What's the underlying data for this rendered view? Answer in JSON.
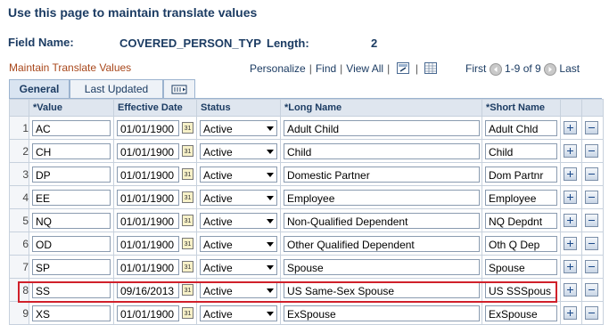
{
  "page": {
    "title": "Use this page to maintain translate values",
    "field_name_label": "Field Name:",
    "field_name_value": "COVERED_PERSON_TYP",
    "length_label": "Length:",
    "length_value": "2"
  },
  "grid": {
    "title": "Maintain Translate Values",
    "personalize": "Personalize",
    "find": "Find",
    "view_all": "View All",
    "first": "First",
    "range": "1-9 of 9",
    "last": "Last",
    "tabs": [
      "General",
      "Last Updated"
    ],
    "columns": [
      "*Value",
      "Effective Date",
      "Status",
      "*Long Name",
      "*Short Name"
    ],
    "rows": [
      {
        "num": "1",
        "value": "AC",
        "date": "01/01/1900",
        "status": "Active",
        "long": "Adult Child",
        "short": "Adult Chld"
      },
      {
        "num": "2",
        "value": "CH",
        "date": "01/01/1900",
        "status": "Active",
        "long": "Child",
        "short": "Child"
      },
      {
        "num": "3",
        "value": "DP",
        "date": "01/01/1900",
        "status": "Active",
        "long": "Domestic Partner",
        "short": "Dom Partnr"
      },
      {
        "num": "4",
        "value": "EE",
        "date": "01/01/1900",
        "status": "Active",
        "long": "Employee",
        "short": "Employee"
      },
      {
        "num": "5",
        "value": "NQ",
        "date": "01/01/1900",
        "status": "Active",
        "long": "Non-Qualified Dependent",
        "short": "NQ Depdnt"
      },
      {
        "num": "6",
        "value": "OD",
        "date": "01/01/1900",
        "status": "Active",
        "long": "Other Qualified Dependent",
        "short": "Oth Q Dep"
      },
      {
        "num": "7",
        "value": "SP",
        "date": "01/01/1900",
        "status": "Active",
        "long": "Spouse",
        "short": "Spouse"
      },
      {
        "num": "8",
        "value": "SS",
        "date": "09/16/2013",
        "status": "Active",
        "long": "US Same-Sex Spouse",
        "short": "US SSSpous"
      },
      {
        "num": "9",
        "value": "XS",
        "date": "01/01/1900",
        "status": "Active",
        "long": "ExSpouse",
        "short": "ExSpouse"
      }
    ]
  },
  "colors": {
    "heading": "#1c3c63",
    "grid_title": "#a8471b",
    "highlight": "#d0202a"
  }
}
